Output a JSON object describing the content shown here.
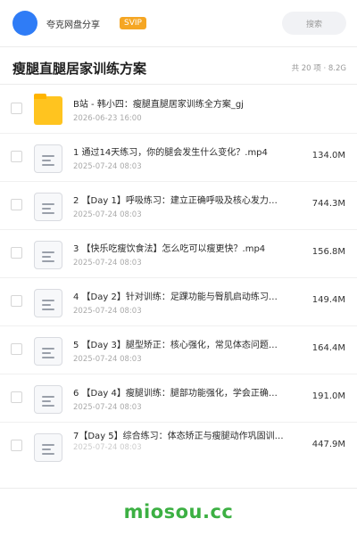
{
  "header": {
    "brand": "夸克网盘分享",
    "badge": "SVIP",
    "search_placeholder": "搜索"
  },
  "page": {
    "title": "瘦腿直腿居家训练方案",
    "meta": "共 20 项 · 8.2G"
  },
  "files": [
    {
      "name": "B站 - 韩小四：瘦腿直腿居家训练全方案_gj",
      "date": "2026-06-23 16:00",
      "size": "",
      "type": "folder"
    },
    {
      "name": "1 通过14天练习，你的腿会发生什么变化？.mp4",
      "date": "2025-07-24 08:03",
      "size": "134.0M",
      "type": "file"
    },
    {
      "name": "2 【Day 1】呼吸练习：建立正确呼吸及核心发力…",
      "date": "2025-07-24 08:03",
      "size": "744.3M",
      "type": "file"
    },
    {
      "name": "3 【快乐吃瘦饮食法】怎么吃可以瘦更快？.mp4",
      "date": "2025-07-24 08:03",
      "size": "156.8M",
      "type": "file"
    },
    {
      "name": "4 【Day 2】针对训练：足踝功能与臀肌启动练习…",
      "date": "2025-07-24 08:03",
      "size": "149.4M",
      "type": "file"
    },
    {
      "name": "5 【Day 3】腿型矫正：核心强化，常见体态问题…",
      "date": "2025-07-24 08:03",
      "size": "164.4M",
      "type": "file"
    },
    {
      "name": "6 【Day 4】瘦腿训练：腿部功能强化，学会正确…",
      "date": "2025-07-24 08:03",
      "size": "191.0M",
      "type": "file"
    },
    {
      "name": "7【Day 5】综合练习：体态矫正与瘦腿动作巩固训…",
      "date": "2025-07-24 08:03",
      "size": "447.9M",
      "type": "file"
    }
  ],
  "footer": {
    "watermark": "miosou.cc"
  },
  "colors": {
    "accent": "#2f7cf6",
    "badge": "#f5a623",
    "folder": "#ffc41f",
    "watermark": "#3cb043"
  }
}
